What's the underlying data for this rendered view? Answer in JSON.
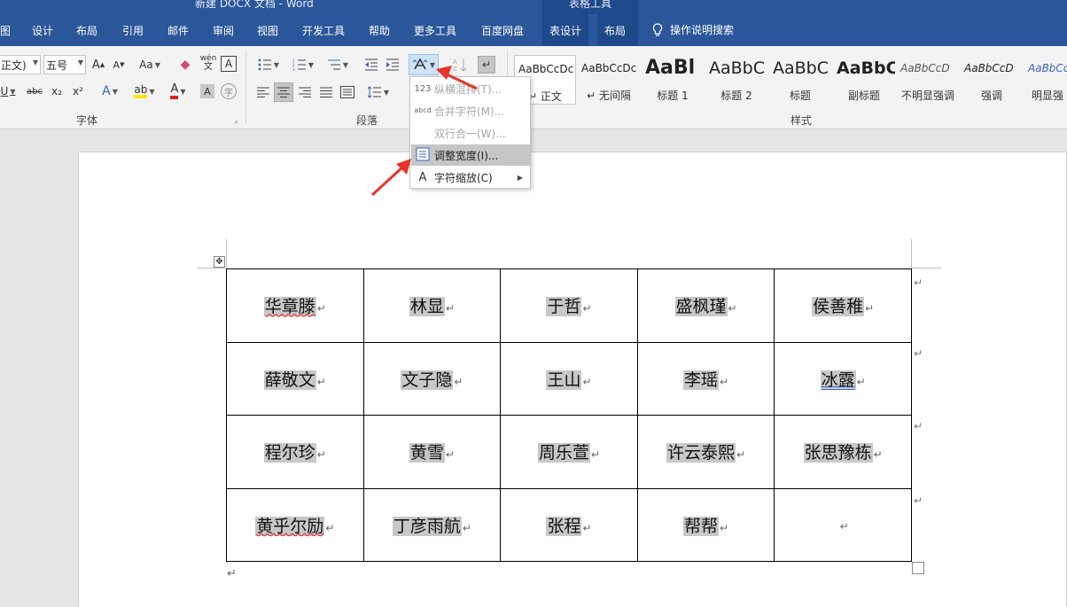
{
  "window": {
    "title": "新建 DOCX 文档  -  Word",
    "context_tab_group": "表格工具"
  },
  "tabs": [
    {
      "label": "图"
    },
    {
      "label": "设计"
    },
    {
      "label": "布局"
    },
    {
      "label": "引用"
    },
    {
      "label": "邮件"
    },
    {
      "label": "审阅"
    },
    {
      "label": "视图"
    },
    {
      "label": "开发工具"
    },
    {
      "label": "帮助"
    },
    {
      "label": "更多工具"
    },
    {
      "label": "百度网盘"
    },
    {
      "label": "表设计"
    },
    {
      "label": "布局"
    }
  ],
  "search": {
    "label": "操作说明搜索"
  },
  "font_group": {
    "font_name": "正文)",
    "font_size": "五号",
    "grow": "A",
    "shrink": "A",
    "change_case": "Aa",
    "phonetic": "wén",
    "border_char": "A",
    "underline": "U",
    "strike": "abc",
    "subscript": "x₂",
    "superscript": "x²",
    "text_effect": "A",
    "highlight": "ab",
    "font_color": "A",
    "shading": "A",
    "enclose": "字",
    "label": "字体"
  },
  "paragraph_group": {
    "label": "段落"
  },
  "styles_group": {
    "label": "样式",
    "items": [
      {
        "sample": "AaBbCcDc",
        "name": "↵ 正文"
      },
      {
        "sample": "AaBbCcDc",
        "name": "↵ 无间隔"
      },
      {
        "sample": "AaBl",
        "name": "标题 1"
      },
      {
        "sample": "AaBbC",
        "name": "标题 2"
      },
      {
        "sample": "AaBbC",
        "name": "标题"
      },
      {
        "sample": "AaBbC",
        "name": "副标题"
      },
      {
        "sample": "AaBbCcD",
        "name": "不明显强调"
      },
      {
        "sample": "AaBbCcD",
        "name": "强调"
      },
      {
        "sample": "AaBbCc",
        "name": "明显强"
      }
    ]
  },
  "dropdown": {
    "items": [
      {
        "label": "纵横混排(T)...",
        "icon": "123"
      },
      {
        "label": "合并字符(M)...",
        "icon": "abcd"
      },
      {
        "label": "双行合一(W)...",
        "icon": ""
      },
      {
        "label": "调整宽度(I)...",
        "icon": ""
      },
      {
        "label": "字符缩放(C)",
        "icon": "A"
      }
    ]
  },
  "table": {
    "rows": [
      [
        "华章滕",
        "林显",
        "于哲",
        "盛枫瑾",
        "侯善稚"
      ],
      [
        "薛敬文",
        "文子隐",
        "王山",
        "李瑶",
        "冰露"
      ],
      [
        "程尔珍",
        "黄雪",
        "周乐萱",
        "许云泰熙",
        "张思豫栋"
      ],
      [
        "黄乎尔励",
        "丁彦雨航",
        "张程",
        "帮帮",
        ""
      ]
    ]
  },
  "marks": {
    "paragraph": "↵"
  },
  "colors": {
    "ribbon_blue": "#2b579a",
    "arrow_red": "#e8342a"
  }
}
